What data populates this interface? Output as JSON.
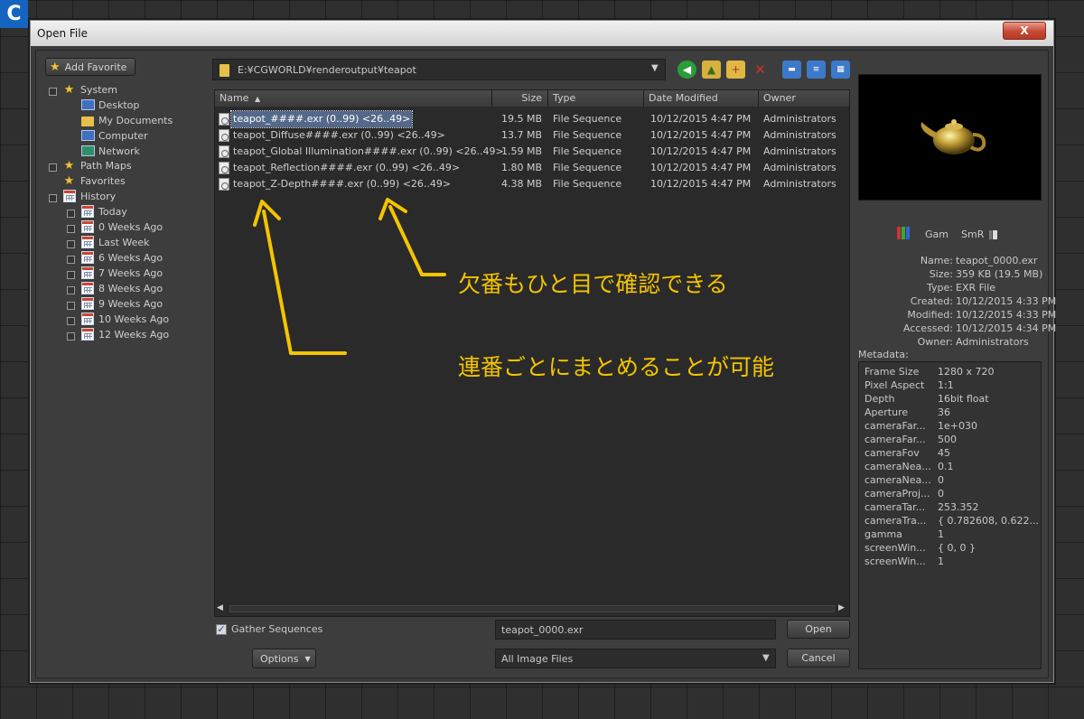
{
  "badge": "C",
  "window": {
    "title": "Open File",
    "close_glyph": "X"
  },
  "sidebar": {
    "add_favorite": "Add Favorite",
    "items": [
      {
        "label": "System",
        "icon": "star-icon"
      },
      {
        "label": "Desktop",
        "icon": "desktop-icon"
      },
      {
        "label": "My Documents",
        "icon": "documents-icon"
      },
      {
        "label": "Computer",
        "icon": "computer-icon"
      },
      {
        "label": "Network",
        "icon": "network-icon"
      },
      {
        "label": "Path Maps",
        "icon": "star-icon"
      },
      {
        "label": "Favorites",
        "icon": "star-icon"
      },
      {
        "label": "History",
        "icon": "calendar-icon"
      },
      {
        "label": "Today",
        "icon": "calendar-icon"
      },
      {
        "label": "0 Weeks Ago",
        "icon": "calendar-icon"
      },
      {
        "label": "Last Week",
        "icon": "calendar-icon"
      },
      {
        "label": "6 Weeks Ago",
        "icon": "calendar-icon"
      },
      {
        "label": "7 Weeks Ago",
        "icon": "calendar-icon"
      },
      {
        "label": "8 Weeks Ago",
        "icon": "calendar-icon"
      },
      {
        "label": "9 Weeks Ago",
        "icon": "calendar-icon"
      },
      {
        "label": "10 Weeks Ago",
        "icon": "calendar-icon"
      },
      {
        "label": "12 Weeks Ago",
        "icon": "calendar-icon"
      }
    ]
  },
  "path": {
    "value": "E:¥CGWORLD¥renderoutput¥teapot"
  },
  "columns": {
    "name": "Name",
    "sort": "▲",
    "size": "Size",
    "type": "Type",
    "date": "Date Modified",
    "owner": "Owner"
  },
  "files": [
    {
      "name": "teapot_####.exr (0..99) <26..49>",
      "size": "19.5 MB",
      "type": "File Sequence",
      "date": "10/12/2015 4:47 PM",
      "owner": "Administrators"
    },
    {
      "name": "teapot_Diffuse####.exr (0..99) <26..49>",
      "size": "13.7 MB",
      "type": "File Sequence",
      "date": "10/12/2015 4:47 PM",
      "owner": "Administrators"
    },
    {
      "name": "teapot_Global Illumination####.exr (0..99) <26..49>",
      "size": "1.59 MB",
      "type": "File Sequence",
      "date": "10/12/2015 4:47 PM",
      "owner": "Administrators"
    },
    {
      "name": "teapot_Reflection####.exr (0..99) <26..49>",
      "size": "1.80 MB",
      "type": "File Sequence",
      "date": "10/12/2015 4:47 PM",
      "owner": "Administrators"
    },
    {
      "name": "teapot_Z-Depth####.exr (0..99) <26..49>",
      "size": "4.38 MB",
      "type": "File Sequence",
      "date": "10/12/2015 4:47 PM",
      "owner": "Administrators"
    }
  ],
  "annotations": {
    "top": "欠番もひと目で確認できる",
    "bottom": "連番ごとにまとめることが可能"
  },
  "bottom": {
    "gather_label": "Gather Sequences",
    "gather_checked": true,
    "filename_value": "teapot_0000.exr",
    "open": "Open",
    "options": "Options",
    "filter_value": "All Image Files",
    "cancel": "Cancel"
  },
  "preview": {
    "gam": "Gam",
    "smr": "SmR"
  },
  "info": [
    {
      "k": "Name:",
      "v": "teapot_0000.exr"
    },
    {
      "k": "Size:",
      "v": "359 KB (19.5 MB)"
    },
    {
      "k": "Type:",
      "v": "EXR File"
    },
    {
      "k": "Created:",
      "v": "10/12/2015 4:33 PM"
    },
    {
      "k": "Modified:",
      "v": "10/12/2015 4:33 PM"
    },
    {
      "k": "Accessed:",
      "v": "10/12/2015 4:34 PM"
    },
    {
      "k": "Owner:",
      "v": "Administrators"
    }
  ],
  "metadata_label": "Metadata:",
  "metadata": [
    {
      "k": "Frame Size",
      "v": "1280 x 720"
    },
    {
      "k": "Pixel Aspect",
      "v": "1:1"
    },
    {
      "k": "Depth",
      "v": "16bit float"
    },
    {
      "k": "Aperture",
      "v": "36"
    },
    {
      "k": "cameraFar...",
      "v": "1e+030"
    },
    {
      "k": "cameraFar...",
      "v": "500"
    },
    {
      "k": "cameraFov",
      "v": "45"
    },
    {
      "k": "cameraNea...",
      "v": "0.1"
    },
    {
      "k": "cameraNea...",
      "v": "0"
    },
    {
      "k": "cameraProj...",
      "v": "0"
    },
    {
      "k": "cameraTar...",
      "v": "253.352"
    },
    {
      "k": "cameraTra...",
      "v": "{ 0.782608, 0.622..."
    },
    {
      "k": "gamma",
      "v": "1"
    },
    {
      "k": "screenWin...",
      "v": "{ 0, 0 }"
    },
    {
      "k": "screenWin...",
      "v": "1"
    }
  ],
  "colors": {
    "accent_annotation": "#f4c400",
    "selection": "#54688a",
    "badge": "#1565c0"
  }
}
